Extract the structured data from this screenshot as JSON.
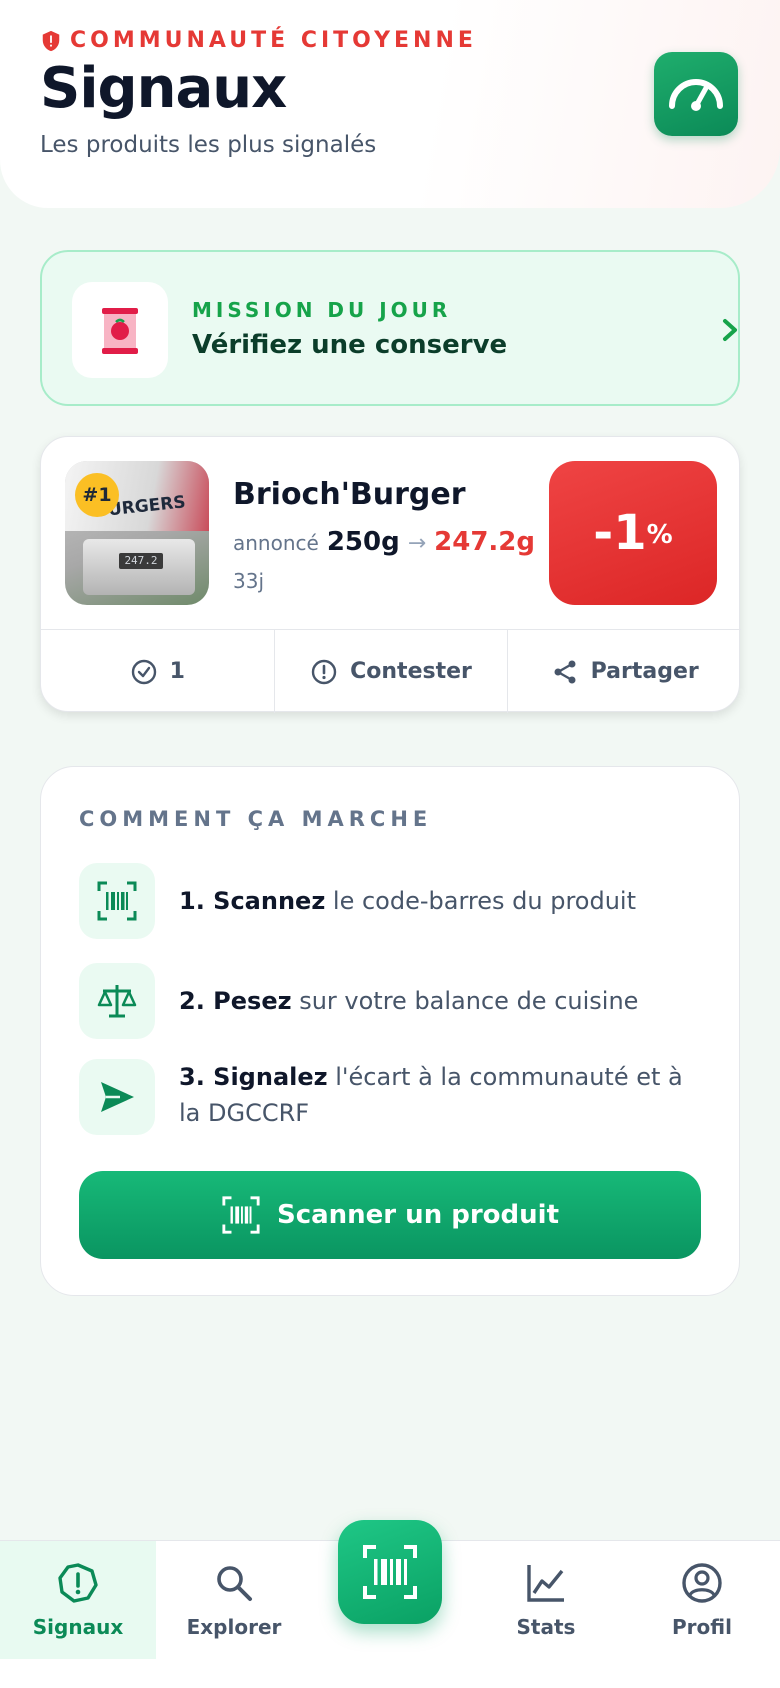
{
  "header": {
    "eyebrow": "COMMUNAUTÉ CITOYENNE",
    "title": "Signaux",
    "subtitle": "Les produits les plus signalés"
  },
  "mission": {
    "label": "MISSION DU JOUR",
    "text": "Vérifiez une conserve"
  },
  "top_report": {
    "rank": "#1",
    "name": "Brioch'Burger",
    "announced_label": "annoncé",
    "announced": "250g",
    "arrow": "→",
    "measured": "247.2g",
    "age": "33j",
    "thumb_pack_text": "BURGERS",
    "thumb_scale_display": "247.2",
    "diff_value": "-1",
    "diff_unit": "%",
    "actions": {
      "confirm_count": "1",
      "contest": "Contester",
      "share": "Partager"
    }
  },
  "howto": {
    "title": "COMMENT ÇA MARCHE",
    "steps": [
      {
        "bold": "1. Scannez",
        "rest": " le code-barres du produit"
      },
      {
        "bold": "2. Pesez",
        "rest": " sur votre balance de cuisine"
      },
      {
        "bold": "3. Signalez",
        "rest": " l'écart à la communauté et à la DGCCRF"
      }
    ],
    "cta": "Scanner un produit"
  },
  "tabbar": {
    "tabs": [
      {
        "label": "Signaux",
        "icon": "alert-circle-icon",
        "active": true
      },
      {
        "label": "Explorer",
        "icon": "search-icon"
      },
      {
        "label": "Stats",
        "icon": "chart-line-icon"
      },
      {
        "label": "Profil",
        "icon": "user-circle-icon"
      }
    ],
    "fab_icon": "barcode-scan-icon"
  },
  "colors": {
    "brand_green": "#0b8a57",
    "alert_red": "#e53935",
    "mission_bg": "#eafaf2",
    "rank_badge": "#fbbf24"
  }
}
